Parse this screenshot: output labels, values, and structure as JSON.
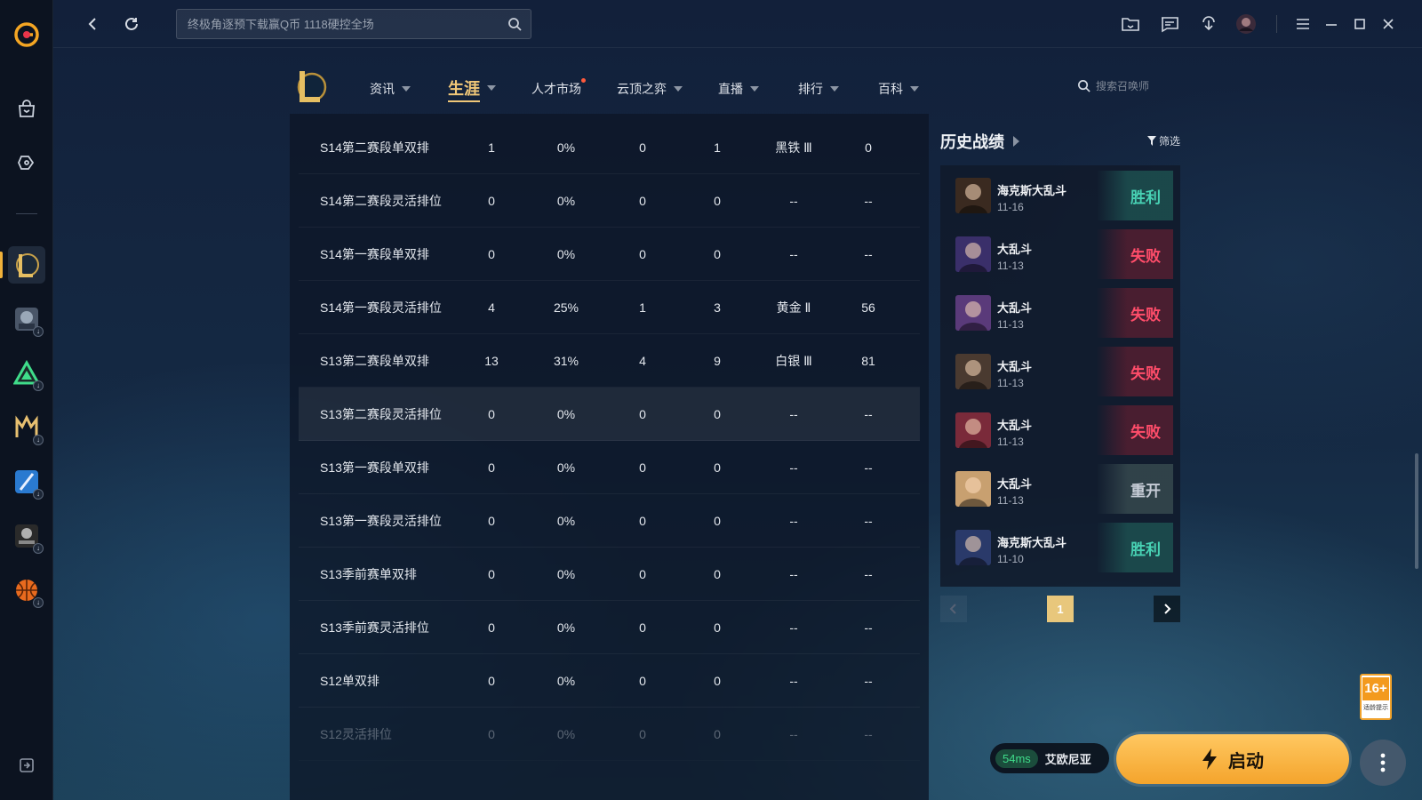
{
  "search": {
    "placeholder": "终极角逐预下载赢Q币 1118硬控全场"
  },
  "nav": {
    "items": [
      {
        "label": "资讯"
      },
      {
        "label": "生涯"
      },
      {
        "label": "人才市场"
      },
      {
        "label": "云顶之弈"
      },
      {
        "label": "直播"
      },
      {
        "label": "排行"
      },
      {
        "label": "百科"
      }
    ],
    "search_placeholder": "搜索召唤师"
  },
  "table": {
    "rows": [
      {
        "name": "S14第二赛段单双排",
        "c1": "1",
        "c2": "0%",
        "c3": "0",
        "c4": "1",
        "tier": "黑铁 Ⅲ",
        "c6": "0"
      },
      {
        "name": "S14第二赛段灵活排位",
        "c1": "0",
        "c2": "0%",
        "c3": "0",
        "c4": "0",
        "tier": "--",
        "c6": "--"
      },
      {
        "name": "S14第一赛段单双排",
        "c1": "0",
        "c2": "0%",
        "c3": "0",
        "c4": "0",
        "tier": "--",
        "c6": "--"
      },
      {
        "name": "S14第一赛段灵活排位",
        "c1": "4",
        "c2": "25%",
        "c3": "1",
        "c4": "3",
        "tier": "黄金 Ⅱ",
        "c6": "56"
      },
      {
        "name": "S13第二赛段单双排",
        "c1": "13",
        "c2": "31%",
        "c3": "4",
        "c4": "9",
        "tier": "白银 Ⅲ",
        "c6": "81"
      },
      {
        "name": "S13第二赛段灵活排位",
        "c1": "0",
        "c2": "0%",
        "c3": "0",
        "c4": "0",
        "tier": "--",
        "c6": "--"
      },
      {
        "name": "S13第一赛段单双排",
        "c1": "0",
        "c2": "0%",
        "c3": "0",
        "c4": "0",
        "tier": "--",
        "c6": "--"
      },
      {
        "name": "S13第一赛段灵活排位",
        "c1": "0",
        "c2": "0%",
        "c3": "0",
        "c4": "0",
        "tier": "--",
        "c6": "--"
      },
      {
        "name": "S13季前赛单双排",
        "c1": "0",
        "c2": "0%",
        "c3": "0",
        "c4": "0",
        "tier": "--",
        "c6": "--"
      },
      {
        "name": "S13季前赛灵活排位",
        "c1": "0",
        "c2": "0%",
        "c3": "0",
        "c4": "0",
        "tier": "--",
        "c6": "--"
      },
      {
        "name": "S12单双排",
        "c1": "0",
        "c2": "0%",
        "c3": "0",
        "c4": "0",
        "tier": "--",
        "c6": "--"
      },
      {
        "name": "S12灵活排位",
        "c1": "0",
        "c2": "0%",
        "c3": "0",
        "c4": "0",
        "tier": "--",
        "c6": "--"
      }
    ]
  },
  "history": {
    "title": "历史战绩",
    "filter_label": "筛选",
    "matches": [
      {
        "mode": "海克斯大乱斗",
        "date": "11-16",
        "result": "胜利",
        "kind": "win",
        "color": "#3a2a20"
      },
      {
        "mode": "大乱斗",
        "date": "11-13",
        "result": "失败",
        "kind": "loss",
        "color": "#3a2f6a"
      },
      {
        "mode": "大乱斗",
        "date": "11-13",
        "result": "失败",
        "kind": "loss",
        "color": "#5a3a7a"
      },
      {
        "mode": "大乱斗",
        "date": "11-13",
        "result": "失败",
        "kind": "loss",
        "color": "#4a3a30"
      },
      {
        "mode": "大乱斗",
        "date": "11-13",
        "result": "失败",
        "kind": "loss",
        "color": "#7a2a3a"
      },
      {
        "mode": "大乱斗",
        "date": "11-13",
        "result": "重开",
        "kind": "remake",
        "color": "#c8a070"
      },
      {
        "mode": "海克斯大乱斗",
        "date": "11-10",
        "result": "胜利",
        "kind": "win",
        "color": "#2a3a6a"
      }
    ],
    "current_page": "1"
  },
  "age_rating": {
    "label": "16+",
    "caption": "适龄提示"
  },
  "server": {
    "ping": "54ms",
    "region": "艾欧尼亚"
  },
  "launch": {
    "label": "启动"
  },
  "colors": {
    "accent": "#f0c778",
    "win": "#48d2b4",
    "loss": "#ff4d6a",
    "launch": "#f4a42c"
  }
}
